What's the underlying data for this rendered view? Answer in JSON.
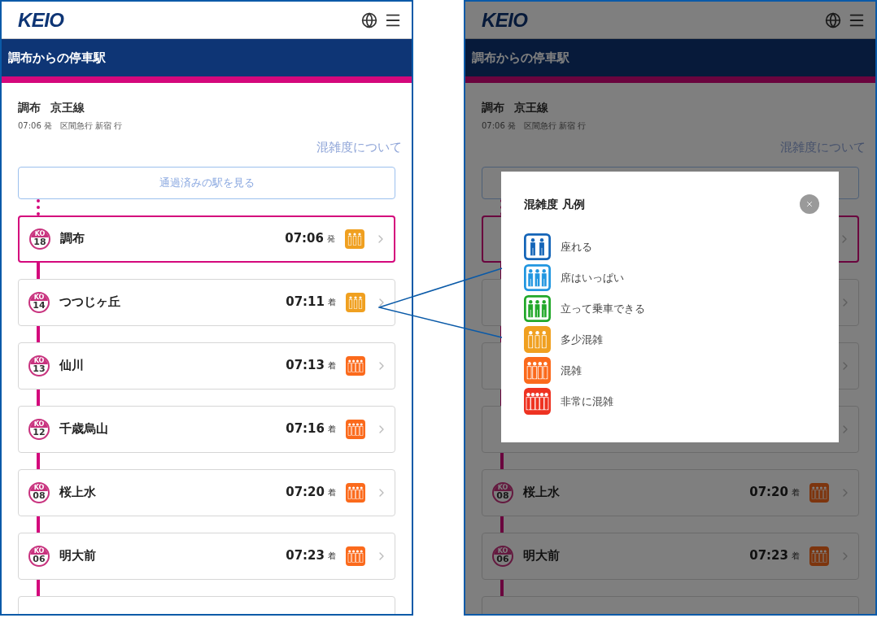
{
  "left_screen": {
    "logo": "KEIO",
    "title": "調布からの停車駅",
    "station": "調布",
    "line": "京王線",
    "departure": "07:06 発　区間急行 新宿 行",
    "congestion_link": "混雑度について",
    "passed_button": "通過済みの駅を見る",
    "stations": [
      {
        "code": "KO",
        "number": "18",
        "name": "調布",
        "time": "07:06",
        "suffix": "発",
        "kind": "somewhat",
        "selected": true
      },
      {
        "code": "KO",
        "number": "14",
        "name": "つつじヶ丘",
        "time": "07:11",
        "suffix": "着",
        "kind": "somewhat",
        "selected": false
      },
      {
        "code": "KO",
        "number": "13",
        "name": "仙川",
        "time": "07:13",
        "suffix": "着",
        "kind": "crowded",
        "selected": false
      },
      {
        "code": "KO",
        "number": "12",
        "name": "千歳烏山",
        "time": "07:16",
        "suffix": "着",
        "kind": "crowded",
        "selected": false
      },
      {
        "code": "KO",
        "number": "08",
        "name": "桜上水",
        "time": "07:20",
        "suffix": "着",
        "kind": "crowded",
        "selected": false
      },
      {
        "code": "KO",
        "number": "06",
        "name": "明大前",
        "time": "07:23",
        "suffix": "着",
        "kind": "crowded",
        "selected": false
      }
    ]
  },
  "right_screen": {
    "logo": "KEIO",
    "title": "調布からの停車駅",
    "station": "調布",
    "line": "京王線",
    "departure": "07:06 発　区間急行 新宿 行",
    "congestion_link": "混雑度について",
    "covered_rows": [
      {
        "selected": true
      },
      {
        "selected": false
      },
      {
        "selected": false
      },
      {
        "selected": false
      }
    ],
    "stations": [
      {
        "code": "KO",
        "number": "08",
        "name": "桜上水",
        "time": "07:20",
        "suffix": "着",
        "kind": "crowded",
        "selected": false
      },
      {
        "code": "KO",
        "number": "06",
        "name": "明大前",
        "time": "07:23",
        "suffix": "着",
        "kind": "crowded",
        "selected": false
      }
    ],
    "modal": {
      "title": "混雑度 凡例",
      "items": [
        {
          "kind": "seated",
          "label": "座れる",
          "color": "#1565b8"
        },
        {
          "kind": "full",
          "label": "席はいっぱい",
          "color": "#2196e0"
        },
        {
          "kind": "standing",
          "label": "立って乗車できる",
          "color": "#22a82a"
        },
        {
          "kind": "somewhat",
          "label": "多少混雑",
          "color": "#f0a020"
        },
        {
          "kind": "crowded",
          "label": "混雑",
          "color": "#fb6a1c"
        },
        {
          "kind": "very",
          "label": "非常に混雑",
          "color": "#ee3322"
        }
      ]
    }
  }
}
